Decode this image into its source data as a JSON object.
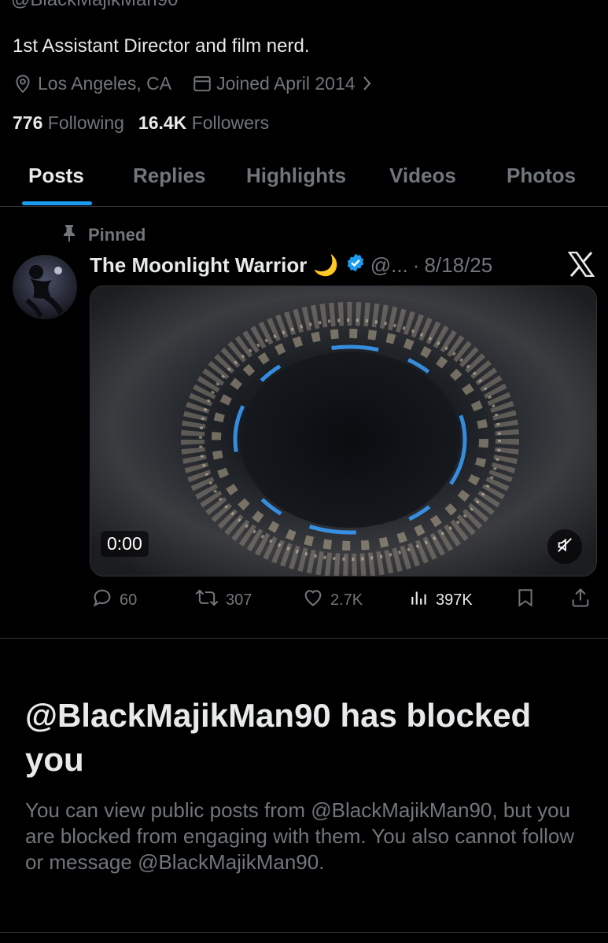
{
  "profile": {
    "handle": "@BlackMajikMan90",
    "bio": "1st Assistant Director and film nerd.",
    "location": "Los Angeles, CA",
    "joined": "Joined April 2014",
    "following_count": "776",
    "following_label": "Following",
    "followers_count": "16.4K",
    "followers_label": "Followers"
  },
  "tabs": [
    {
      "label": "Posts",
      "active": true
    },
    {
      "label": "Replies",
      "active": false
    },
    {
      "label": "Highlights",
      "active": false
    },
    {
      "label": "Videos",
      "active": false
    },
    {
      "label": "Photos",
      "active": false
    }
  ],
  "post": {
    "pinned_label": "Pinned",
    "author_name": "The Moonlight Warrior",
    "author_emoji": "🌙",
    "author_handle": "@...",
    "date": "8/18/25",
    "video_time": "0:00",
    "replies": "60",
    "reposts": "307",
    "likes": "2.7K",
    "views": "397K"
  },
  "blocked": {
    "title": "@BlackMajikMan90 has blocked you",
    "body": "You can view public posts from @BlackMajikMan90, but you are blocked from engaging with them. You also cannot follow or message @BlackMajikMan90."
  },
  "colors": {
    "background": "#000000",
    "text": "#e7e9ea",
    "muted": "#71767b",
    "accent": "#1d9bf0",
    "divider": "#2f3336"
  },
  "icons": [
    "location-icon",
    "calendar-icon",
    "chevron-right-icon",
    "pin-icon",
    "verified-badge-icon",
    "x-logo-icon",
    "mute-icon",
    "reply-icon",
    "repost-icon",
    "like-icon",
    "views-icon",
    "bookmark-icon",
    "share-icon"
  ]
}
